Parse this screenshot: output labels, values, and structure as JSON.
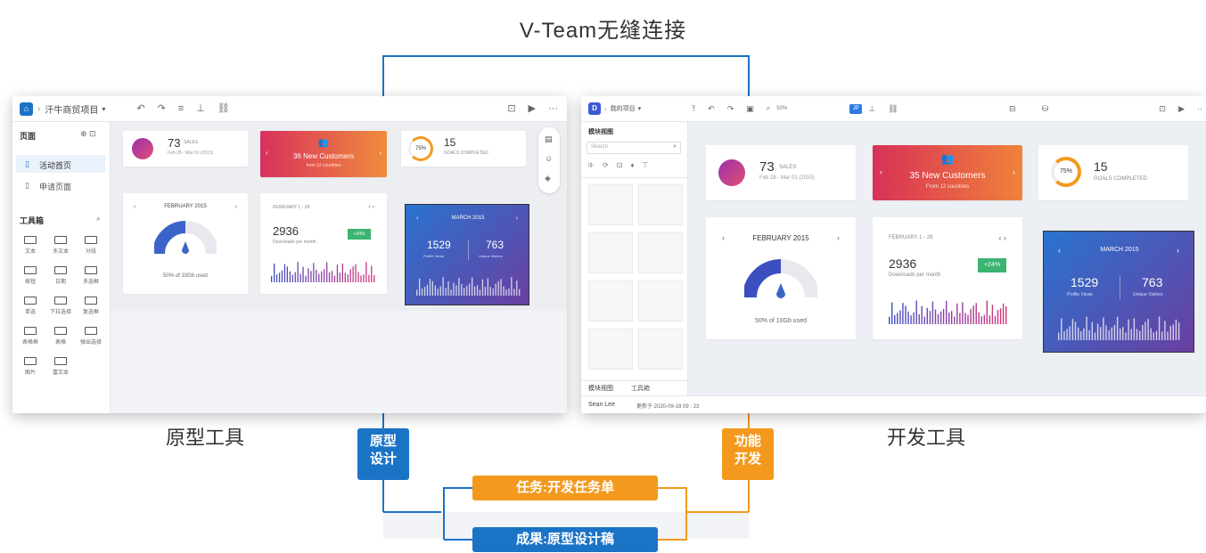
{
  "title": "V-Team无缝连接",
  "left_label": "原型工具",
  "right_label": "开发工具",
  "tag_prototype": "原型\n设计",
  "tag_prototype_l1": "原型",
  "tag_prototype_l2": "设计",
  "tag_dev_l1": "功能",
  "tag_dev_l2": "开发",
  "bar_task": "任务:开发任务单",
  "bar_result": "成果:原型设计稿",
  "colors": {
    "blue": "#1b73c6",
    "orange": "#f39a1e",
    "accent_purple": "#6a3fa0",
    "accent_red": "#e04a5b",
    "green": "#3cb371"
  },
  "proto": {
    "breadcrumb": "汗牛商贸项目",
    "pages_header": "页面",
    "pages": [
      "活动首页",
      "申请页面"
    ],
    "toolbox_header": "工具箱",
    "tools": [
      [
        "文本",
        "多文本",
        "分段"
      ],
      [
        "按钮",
        "日期",
        "多选框"
      ],
      [
        "单选",
        "下拉选择",
        "复选框"
      ],
      [
        "表格框",
        "表格",
        "弹出选择"
      ],
      [
        "图片",
        "富文本"
      ]
    ],
    "sales_value": "73",
    "sales_label": "SALES",
    "sales_date": "Feb 28 - Mar 01 (2015)",
    "customers": "36 New Customers",
    "customers_sub": "from 12 countries",
    "goals_percent": "75%",
    "goals_value": "15",
    "goals_label": "GOALS COMPLETED",
    "month": "FEBRUARY 2015",
    "used": "50% of 10Gb used",
    "range": "FEBRUARY 1 - 28",
    "downloads": "2936",
    "downloads_label": "Downloads per month",
    "delta": "+24%",
    "march": "MARCH 2015",
    "page_views": "1529",
    "page_views_label": "Profile Views",
    "unique": "763",
    "unique_label": "Unique Visitors"
  },
  "dev": {
    "breadcrumb": "我的项目",
    "zoom": "50%",
    "module_header": "模块视图",
    "search_placeholder": "Search",
    "tab_module": "模块视图",
    "tab_toolbox": "工具箱",
    "user": "Sean Lee",
    "updated": "更新于  2020-09-18  09 : 23",
    "sales_value": "73",
    "sales_label": "SALES",
    "sales_date": "Feb 28 - Mar 01 (2015)",
    "customers": "35 New Customers",
    "customers_sub": "From 12 countries",
    "goals_percent": "75%",
    "goals_value": "15",
    "goals_label": "GOALS COMPLETED",
    "month": "FEBRUARY 2015",
    "used": "50% of 10Gb used",
    "range": "FEBRUARY 1 - 28",
    "downloads": "2936",
    "downloads_label": "Downloads per month",
    "delta": "+24%",
    "march": "MARCH 2015",
    "page_views": "1529",
    "page_views_label": "Profile Views",
    "unique": "763",
    "unique_label": "Unique Visitors"
  }
}
